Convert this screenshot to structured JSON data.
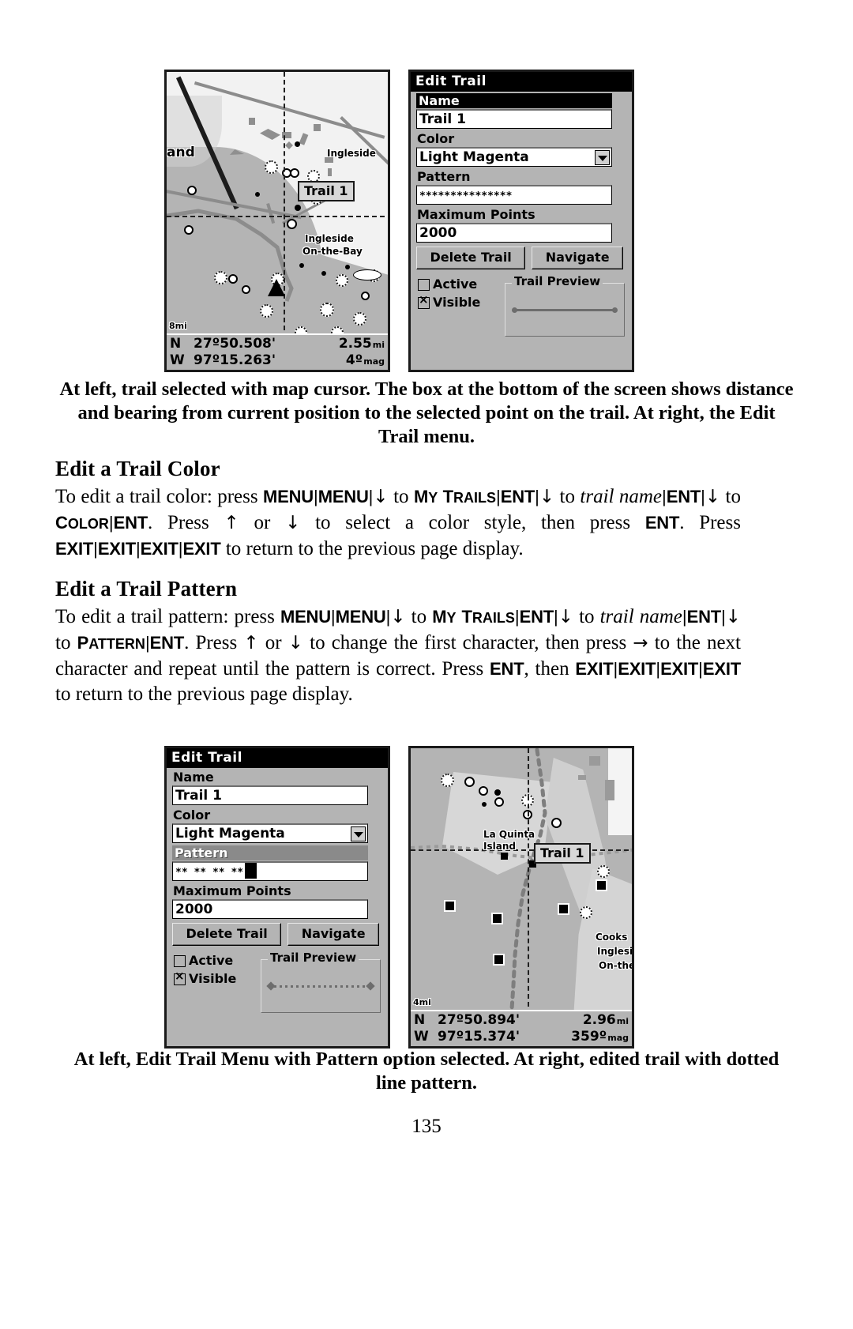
{
  "page": {
    "number": "135"
  },
  "figure_top": {
    "map": {
      "labels": [
        {
          "text": "and"
        },
        {
          "text": "Ingleside"
        },
        {
          "text": "Ingleside"
        },
        {
          "text": "On-the-Bay"
        }
      ],
      "trail_tag": "Trail 1",
      "scale": "8mi",
      "status": {
        "lat_hemi": "N",
        "lat": "27º50.508'",
        "lon_hemi": "W",
        "lon": "97º15.263'",
        "distance": "2.55",
        "distance_unit": "mi",
        "bearing": "4º",
        "bearing_unit": "mag"
      }
    },
    "menu": {
      "title": "Edit Trail",
      "name_label": "Name",
      "name_value": "Trail 1",
      "color_label": "Color",
      "color_value": "Light Magenta",
      "pattern_label": "Pattern",
      "pattern_value": "***************",
      "max_points_label": "Maximum Points",
      "max_points_value": "2000",
      "delete_button": "Delete Trail",
      "navigate_button": "Navigate",
      "active_label": "Active",
      "visible_label": "Visible",
      "preview_label": "Trail Preview",
      "selected_field": "Name"
    }
  },
  "caption_top": "At left, trail selected with map cursor. The box at the bottom of the screen shows distance and bearing from current position to the selected point on the trail. At right, the Edit Trail menu.",
  "section_color": {
    "heading": "Edit a Trail Color",
    "body_parts": {
      "p1": "To edit a trail color: press ",
      "k1": "MENU",
      "s1": "|",
      "k2": "MENU",
      "s2": "|",
      "a1": "↓",
      "p2": " to ",
      "k3": "My Trails",
      "s3": "|",
      "k4": "ENT",
      "s4": "|",
      "a2": "↓",
      "p3": " to ",
      "i1": "trail name",
      "s5": "|",
      "k5": "ENT",
      "s6": "|",
      "a3": "↓",
      "p4": " to ",
      "k6": "Color",
      "s7": "|",
      "k7": "ENT",
      "p5": ". Press ",
      "a4": "↑",
      "p6": " or ",
      "a5": "↓",
      "p7": " to select a color style, then press ",
      "k8": "ENT",
      "p8": ". Press ",
      "k9": "EXIT",
      "s8": "|",
      "k10": "EXIT",
      "s9": "|",
      "k11": "EXIT",
      "s10": "|",
      "k12": "EXIT",
      "p9": " to return to the previous page display."
    }
  },
  "section_pattern": {
    "heading": "Edit a Trail Pattern",
    "body_parts": {
      "p1": "To edit a trail pattern: press ",
      "k1": "MENU",
      "s1": "|",
      "k2": "MENU",
      "s2": "|",
      "a1": "↓",
      "p2": " to ",
      "k3": "My Trails",
      "s3": "|",
      "k4": "ENT",
      "s4": "|",
      "a2": "↓",
      "p3": " to ",
      "i1": "trail name",
      "s5": "|",
      "k5": "ENT",
      "s6": "|",
      "a3": "↓",
      "p4": " to ",
      "k6": "Pattern",
      "s7": "|",
      "k7": "ENT",
      "p5": ". Press ",
      "a4": "↑",
      "p6": " or ",
      "a5": "↓",
      "p7": " to change the first character, then press ",
      "a6": "→",
      "p8": " to the next character and repeat until the pattern is correct. Press ",
      "k8": "ENT",
      "p9": ", then ",
      "k9": "EXIT",
      "s8": "|",
      "k10": "EXIT",
      "s9": "|",
      "k11": "EXIT",
      "s10": "|",
      "k12": "EXIT",
      "p10": " to return to the previous page display."
    }
  },
  "figure_bottom": {
    "menu": {
      "title": "Edit Trail",
      "name_label": "Name",
      "name_value": "Trail 1",
      "color_label": "Color",
      "color_value": "Light Magenta",
      "pattern_label": "Pattern",
      "pattern_value": "**   **   **   **",
      "max_points_label": "Maximum Points",
      "max_points_value": "2000",
      "delete_button": "Delete Trail",
      "navigate_button": "Navigate",
      "active_label": "Active",
      "visible_label": "Visible",
      "preview_label": "Trail Preview",
      "selected_field": "Pattern"
    },
    "map": {
      "labels": [
        {
          "text": "La Quinta"
        },
        {
          "text": "Island"
        },
        {
          "text": "Cooks"
        },
        {
          "text": "Inglesi"
        },
        {
          "text": "On-the"
        }
      ],
      "trail_tag": "Trail 1",
      "scale": "4mi",
      "status": {
        "lat_hemi": "N",
        "lat": "27º50.894'",
        "lon_hemi": "W",
        "lon": "97º15.374'",
        "distance": "2.96",
        "distance_unit": "mi",
        "bearing": "359º",
        "bearing_unit": "mag"
      }
    }
  },
  "caption_bottom": "At left, Edit Trail Menu with Pattern option selected. At right, edited trail with dotted line pattern.",
  "colors": {
    "screen_bg": "#b4b4b4",
    "title_bar": "#000000",
    "selected_gray": "#8a8a8a",
    "map_water": "#f2f2f2",
    "map_land": "#b4b4b4"
  }
}
